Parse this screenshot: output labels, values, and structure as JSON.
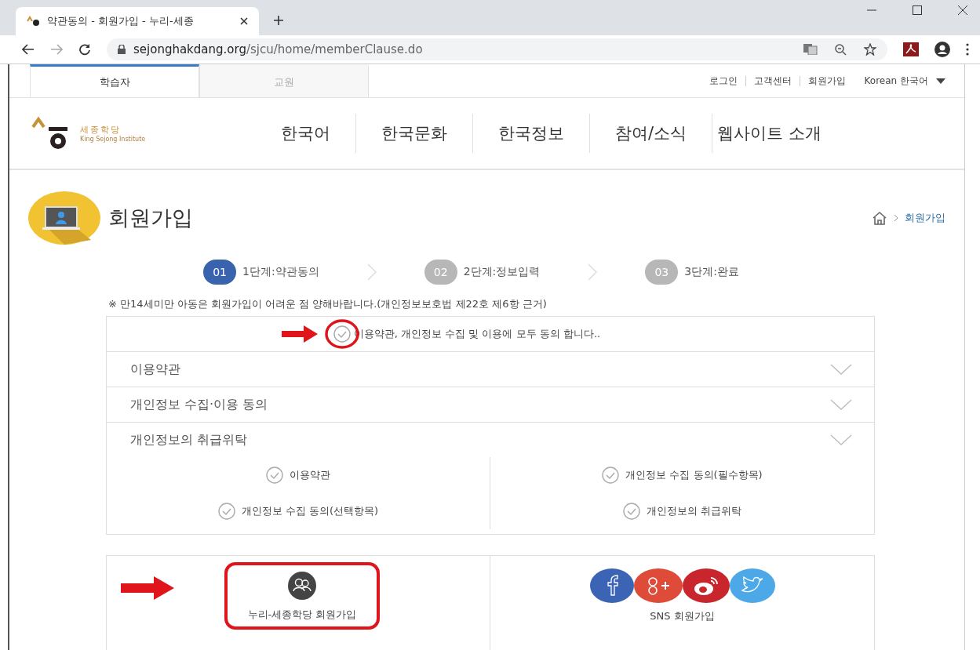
{
  "browser": {
    "tab_title": "약관동의 - 회원가입 - 누리-세종",
    "url_domain": "sejonghakdang.org",
    "url_path": "/sjcu/home/memberClause.do"
  },
  "user_tabs": [
    {
      "label": "학습자",
      "selected": true
    },
    {
      "label": "교원",
      "selected": false
    }
  ],
  "top_links": [
    "로그인",
    "고객센터",
    "회원가입"
  ],
  "language": "Korean 한국어",
  "logo": {
    "hangul": "세종학당",
    "english": "King Sejong Institute"
  },
  "nav": [
    "한국어",
    "한국문화",
    "한국정보",
    "참여/소식",
    "웹사이트 소개"
  ],
  "page_title": "회원가입",
  "breadcrumb_current": "회원가입",
  "steps": [
    {
      "number": "01",
      "label": "1단계:약관동의",
      "selected": true
    },
    {
      "number": "02",
      "label": "2단계:정보입력",
      "selected": false
    },
    {
      "number": "03",
      "label": "3단계:완료",
      "selected": false
    }
  ],
  "notice": "※ 만14세미만 아동은 회원가입이 어려운 점 양해바랍니다.(개인정보보호법 제22호 제6항 근거)",
  "agree_all": {
    "label": "이용약관, 개인정보 수집 및 이용에 모두 동의 합니다..",
    "checked": false
  },
  "sections": [
    {
      "title": "이용약관"
    },
    {
      "title": "개인정보 수집·이용 동의"
    },
    {
      "title": "개인정보의 취급위탁"
    }
  ],
  "consents": [
    {
      "label": "이용약관",
      "checked": false
    },
    {
      "label": "개인정보 수집 동의(필수항목)",
      "checked": false
    },
    {
      "label": "개인정보 수집 동의(선택항목)",
      "checked": false
    },
    {
      "label": "개인정보의 취급위탁",
      "checked": false
    }
  ],
  "join_options": [
    {
      "kind": "member",
      "label": "누리-세종학당 회원가입"
    },
    {
      "kind": "sns",
      "label": "SNS 회원가입"
    }
  ]
}
